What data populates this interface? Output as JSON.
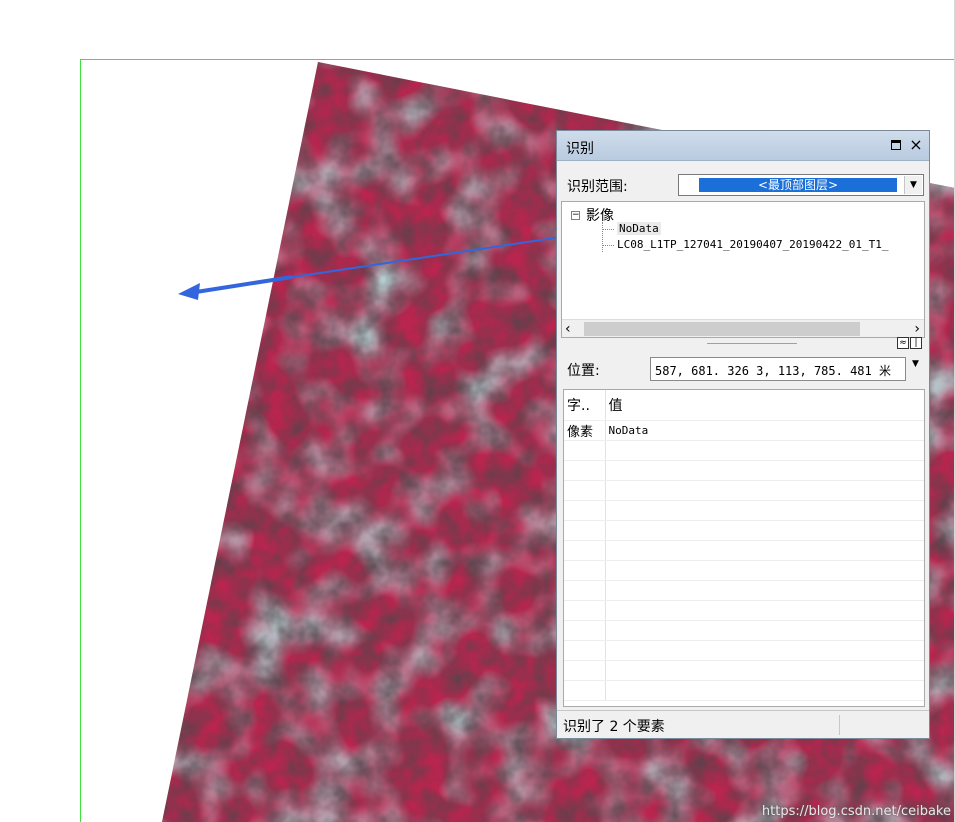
{
  "identify_window": {
    "title": "识别",
    "close_glyph": "×",
    "scope_label": "识别范围:",
    "scope_value": "<最顶部图层>",
    "tree": {
      "root_label": "影像",
      "items": [
        "NoData",
        "LC08_L1TP_127041_20190407_20190422_01_T1_"
      ]
    },
    "location_label": "位置:",
    "location_value": "587, 681. 326   3, 113, 785. 481  米",
    "results": {
      "headers": [
        "字..",
        "值"
      ],
      "rows": [
        {
          "field": "像素",
          "value": "NoData"
        }
      ]
    },
    "status_text": "识别了 2 个要素"
  },
  "watermark": "https://blog.csdn.net/ceibake",
  "colors": {
    "frame_green": "#3ee03e",
    "arrow_blue": "#3366dd",
    "selection_blue": "#1a6fd8",
    "image_red": "#b8254e",
    "image_cyan": "#74c4c0"
  }
}
